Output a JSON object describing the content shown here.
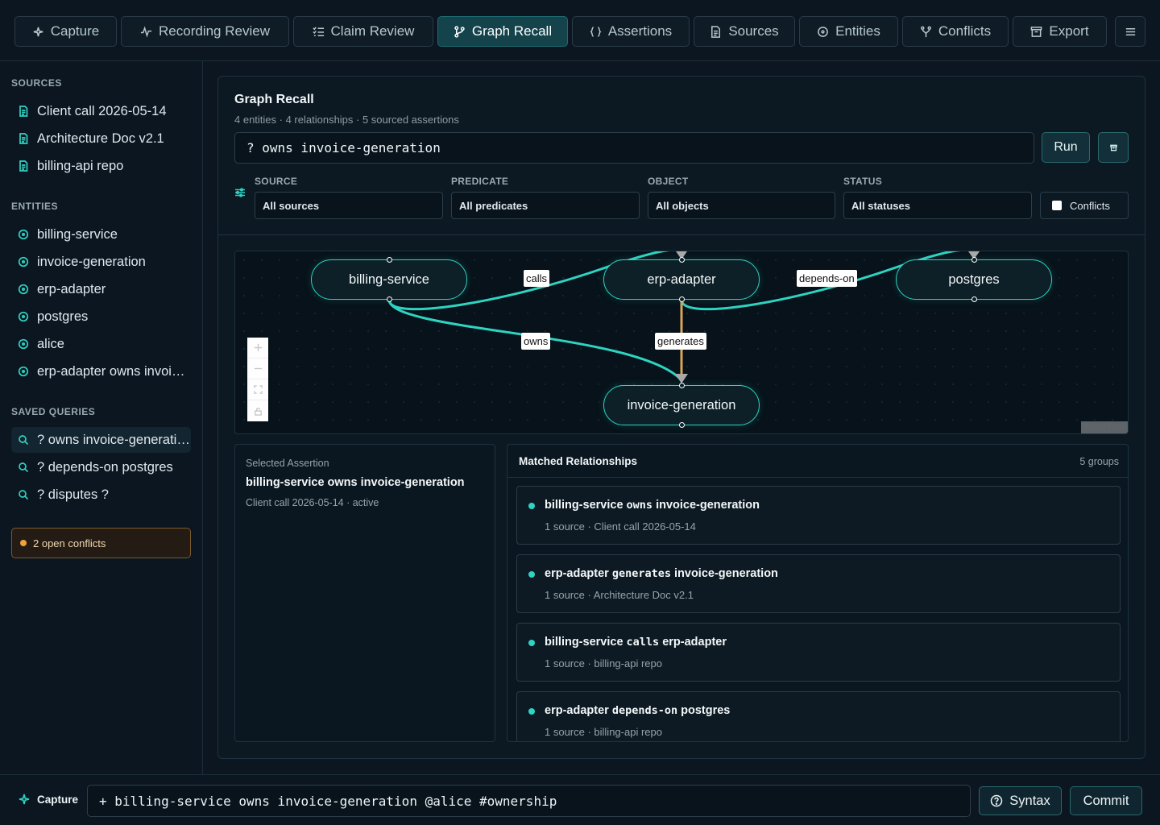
{
  "nav": {
    "tabs": [
      {
        "label": "Capture",
        "icon": "sparkle-icon"
      },
      {
        "label": "Recording Review",
        "icon": "activity-icon"
      },
      {
        "label": "Claim Review",
        "icon": "checklist-icon"
      },
      {
        "label": "Graph Recall",
        "icon": "branch-icon",
        "active": true
      },
      {
        "label": "Assertions",
        "icon": "braces-icon"
      },
      {
        "label": "Sources",
        "icon": "file-icon"
      },
      {
        "label": "Entities",
        "icon": "circle-icon"
      },
      {
        "label": "Conflicts",
        "icon": "merge-icon"
      },
      {
        "label": "Export",
        "icon": "archive-icon"
      }
    ],
    "menu_icon": "menu-icon"
  },
  "sidebar": {
    "sources_title": "SOURCES",
    "sources": [
      "Client call 2026-05-14",
      "Architecture Doc v2.1",
      "billing-api repo"
    ],
    "entities_title": "ENTITIES",
    "entities": [
      "billing-service",
      "invoice-generation",
      "erp-adapter",
      "postgres",
      "alice",
      "erp-adapter owns invoice-generation"
    ],
    "saved_title": "SAVED QUERIES",
    "saved_queries": [
      "? owns invoice-generation",
      "? depends-on postgres",
      "? disputes ?"
    ],
    "conflicts_label": "2 open conflicts"
  },
  "panel": {
    "title": "Graph Recall",
    "subtitle": "4 entities · 4 relationships · 5 sourced assertions",
    "query": "? owns invoice-generation",
    "run_label": "Run",
    "filters": {
      "source_label": "SOURCE",
      "source_value": "All sources",
      "predicate_label": "PREDICATE",
      "predicate_value": "All predicates",
      "object_label": "OBJECT",
      "object_value": "All objects",
      "status_label": "STATUS",
      "status_value": "All statuses",
      "conflicts_label": "Conflicts"
    }
  },
  "graph": {
    "nodes": [
      "billing-service",
      "erp-adapter",
      "postgres",
      "invoice-generation"
    ],
    "edges": [
      "calls",
      "depends-on",
      "owns",
      "generates"
    ],
    "attribution": "React Flow"
  },
  "selected": {
    "caption": "Selected Assertion",
    "title": "billing-service owns invoice-generation",
    "meta": "Client call 2026-05-14 · active"
  },
  "matched": {
    "title": "Matched Relationships",
    "count": "5 groups",
    "items": [
      {
        "subject": "billing-service",
        "predicate": "owns",
        "object": "invoice-generation",
        "source": "1 source · Client call 2026-05-14"
      },
      {
        "subject": "erp-adapter",
        "predicate": "generates",
        "object": "invoice-generation",
        "source": "1 source · Architecture Doc v2.1"
      },
      {
        "subject": "billing-service",
        "predicate": "calls",
        "object": "erp-adapter",
        "source": "1 source · billing-api repo"
      },
      {
        "subject": "erp-adapter",
        "predicate": "depends-on",
        "object": "postgres",
        "source": "1 source · billing-api repo"
      }
    ]
  },
  "bottom": {
    "capture_label": "Capture",
    "input_value": "+ billing-service owns invoice-generation @alice #ownership",
    "syntax_label": "Syntax",
    "commit_label": "Commit"
  },
  "colors": {
    "accent": "#2fd3c1",
    "generates_edge": "#d9a55b",
    "background": "#0b1620"
  }
}
